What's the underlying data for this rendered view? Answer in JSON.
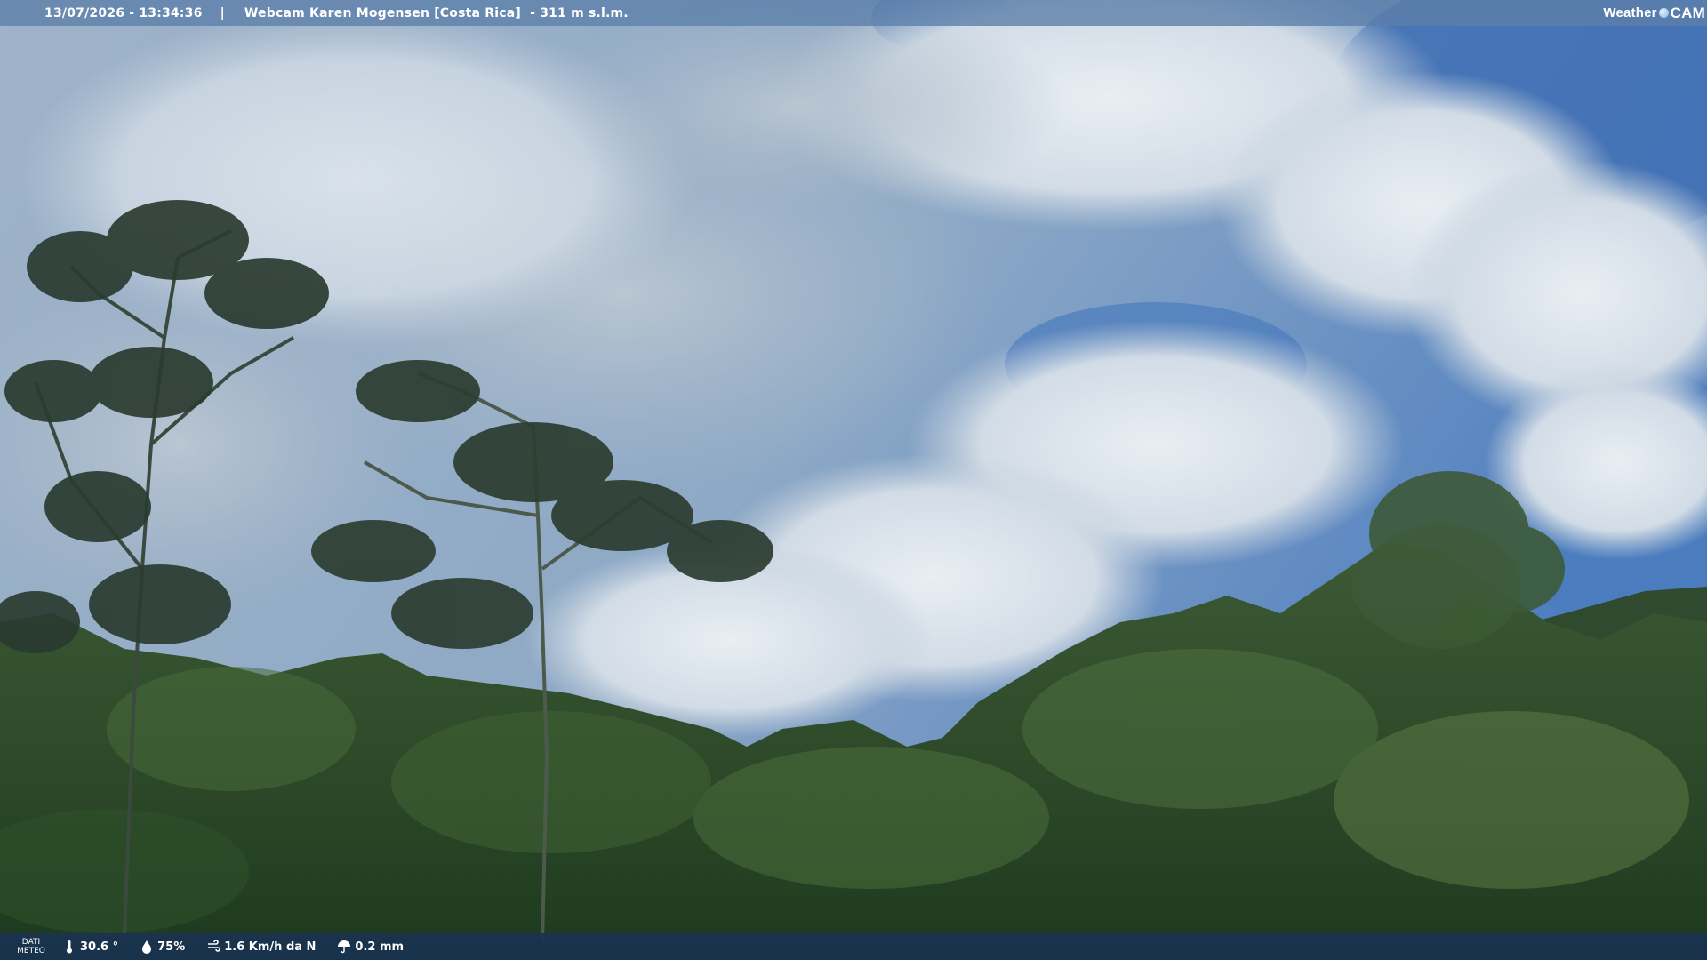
{
  "header": {
    "timestamp": "13/07/2026 - 13:34:36",
    "separator": "|",
    "title": "Webcam Karen Mogensen [Costa Rica]  - 311 m s.l.m.",
    "brand_left": "Weather",
    "brand_right": "CAM"
  },
  "footer": {
    "label_line1": "DATI",
    "label_line2": "METEO",
    "temperature": "30.6 °",
    "humidity": "75%",
    "wind": "1.6 Km/h da N",
    "rain": "0.2 mm",
    "icons": [
      "thermometer-icon",
      "humidity-icon",
      "wind-icon",
      "rain-icon"
    ]
  },
  "colors": {
    "sky": "#5b88c4",
    "cloud": "#dfe7ee",
    "forest": "#2f4d2a",
    "bar_top": "#5c80aa",
    "bar_bottom": "#1a3254"
  }
}
